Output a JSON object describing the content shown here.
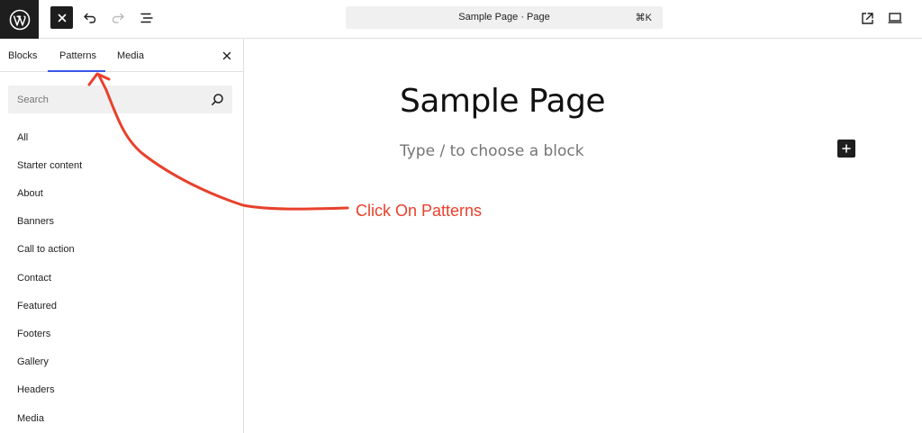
{
  "toolbar": {
    "document_title": "Sample Page · Page",
    "shortcut": "⌘K"
  },
  "sidebar": {
    "tabs": [
      {
        "label": "Blocks",
        "active": false
      },
      {
        "label": "Patterns",
        "active": true
      },
      {
        "label": "Media",
        "active": false
      }
    ],
    "search_placeholder": "Search",
    "categories": [
      {
        "label": "All"
      },
      {
        "label": "Starter content"
      },
      {
        "label": "About"
      },
      {
        "label": "Banners"
      },
      {
        "label": "Call to action"
      },
      {
        "label": "Contact"
      },
      {
        "label": "Featured"
      },
      {
        "label": "Footers"
      },
      {
        "label": "Gallery"
      },
      {
        "label": "Headers"
      },
      {
        "label": "Media"
      }
    ]
  },
  "canvas": {
    "title": "Sample Page",
    "placeholder": "Type / to choose a block"
  },
  "annotation": {
    "text": "Click On Patterns",
    "color": "#e8412c"
  },
  "colors": {
    "accent": "#3858e9",
    "dark": "#1e1e1e"
  }
}
